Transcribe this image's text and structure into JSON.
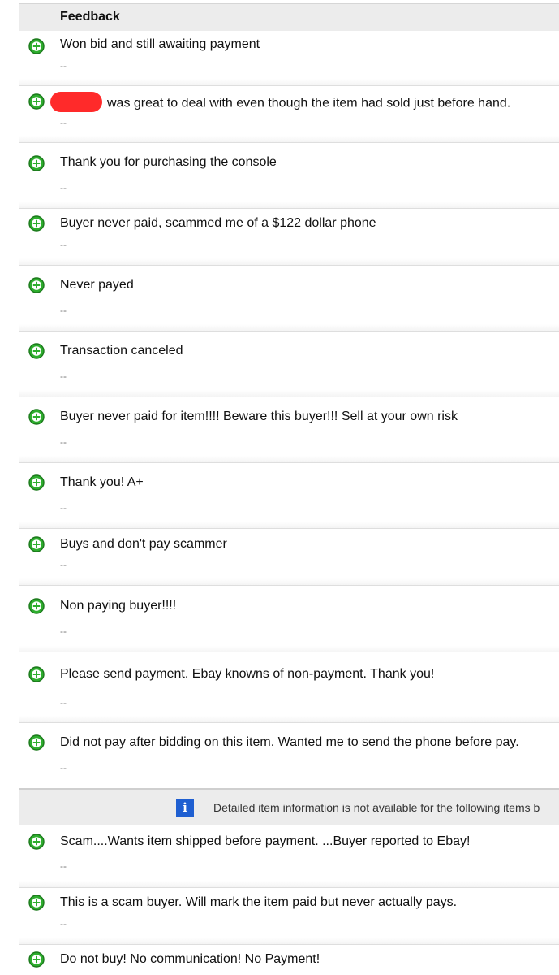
{
  "header": {
    "title": "Feedback"
  },
  "rows_a": [
    {
      "comment": "Won bid and still awaiting payment",
      "response": "--"
    },
    {
      "comment": "was great to deal with even though the item had sold just before hand.",
      "response": "--",
      "redacted": true
    },
    {
      "comment": "Thank you for purchasing the console",
      "response": "--"
    },
    {
      "comment": "Buyer never paid, scammed me of a $122 dollar phone",
      "response": "--"
    },
    {
      "comment": "Never payed",
      "response": "--"
    },
    {
      "comment": "Transaction canceled",
      "response": "--"
    },
    {
      "comment": "Buyer never paid for item!!!! Beware this buyer!!! Sell at your own risk",
      "response": "--"
    },
    {
      "comment": "Thank you! A+",
      "response": "--"
    },
    {
      "comment": "Buys and don't pay scammer",
      "response": "--"
    },
    {
      "comment": "Non paying buyer!!!!",
      "response": "--"
    },
    {
      "comment": "Please send payment. Ebay knowns of non-payment. Thank you!",
      "response": "--"
    },
    {
      "comment": "Did not pay after bidding on this item. Wanted me to send the phone before pay.",
      "response": "--"
    }
  ],
  "info": {
    "icon": "info-icon",
    "text": "Detailed item information is not available for the following items b"
  },
  "rows_b": [
    {
      "comment": "Scam....Wants item shipped before payment. ...Buyer reported to Ebay!",
      "response": "--"
    },
    {
      "comment": "This is a scam buyer. Will mark the item paid but never actually pays.",
      "response": "--"
    },
    {
      "comment": "Do not buy! No communication! No Payment!",
      "response": ""
    }
  ],
  "rating_icon": "positive-plus-icon",
  "colors": {
    "positive": "#2eae2e",
    "info": "#1f5fd1",
    "redaction": "#ff2a2a"
  }
}
